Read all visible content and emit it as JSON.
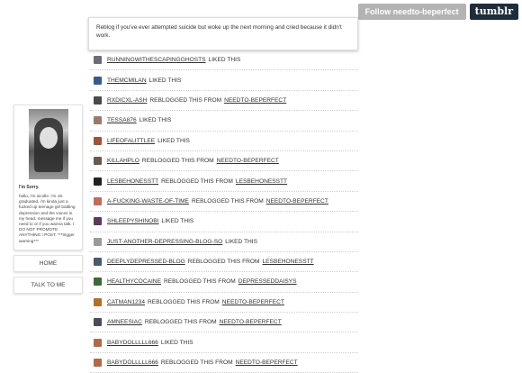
{
  "topbar": {
    "follow_label": "Follow needto-beperfect",
    "tumblr_label": "tumblr"
  },
  "post": {
    "text": "Reblog if you've ever attempted suicide but woke up the next morning and cried because it didn't work."
  },
  "notes": [
    {
      "user": "RUNNINGWITHESCAPINGGHOSTS",
      "action": "LIKED THIS",
      "from": "",
      "color": "#6b6b7a"
    },
    {
      "user": "THEMCMILAN",
      "action": "LIKED THIS",
      "from": "",
      "color": "#3a5a8a"
    },
    {
      "user": "RXDICXL-ASH",
      "action": "REBLOGGED THIS FROM",
      "from": "NEEDTO-BEPERFECT",
      "color": "#4a4a4a"
    },
    {
      "user": "TESSA876",
      "action": "LIKED THIS",
      "from": "",
      "color": "#9a7a6a"
    },
    {
      "user": "LIFEOFALITTLEE",
      "action": "LIKED THIS",
      "from": "",
      "color": "#a0523a"
    },
    {
      "user": "KILLAHPLO",
      "action": "REBLOGGED THIS FROM",
      "from": "NEEDTO-BEPERFECT",
      "color": "#6a5a4a"
    },
    {
      "user": "LESBEHONESSTT",
      "action": "REBLOGGED THIS FROM",
      "from": "LESBEHONESSTT",
      "color": "#222222"
    },
    {
      "user": "A-FUCKING-WASTE-OF-TIME",
      "action": "REBLOGGED THIS FROM",
      "from": "NEEDTO-BEPERFECT",
      "color": "#c46a5a"
    },
    {
      "user": "SHLEEPYSHINOBI",
      "action": "LIKED THIS",
      "from": "",
      "color": "#5a3a5a"
    },
    {
      "user": "JUST-ANOTHER-DEPRESSING-BLOG-SO",
      "action": "LIKED THIS",
      "from": "",
      "color": "#9a9a9a"
    },
    {
      "user": "DEEPLYDEPRESSED-BLOG",
      "action": "REBLOGGED THIS FROM",
      "from": "LESBEHONESSTT",
      "color": "#4a5a6a"
    },
    {
      "user": "HEALTHYCOCAINE",
      "action": "REBLOGGED THIS FROM",
      "from": "DEPRESSEDDAISYS",
      "color": "#3a6a3a"
    },
    {
      "user": "CATMAN1234",
      "action": "REBLOGGED THIS FROM",
      "from": "NEEDTO-BEPERFECT",
      "color": "#b0702a"
    },
    {
      "user": "AMNEESIAC",
      "action": "REBLOGGED THIS FROM",
      "from": "NEEDTO-BEPERFECT",
      "color": "#4a4a5a"
    },
    {
      "user": "BABYDOLLLLL666",
      "action": "LIKED THIS",
      "from": "",
      "color": "#b06a4a"
    },
    {
      "user": "BABYDOLLLLL666",
      "action": "REBLOGGED THIS FROM",
      "from": "NEEDTO-BEPERFECT",
      "color": "#b06a4a"
    }
  ],
  "sidebar": {
    "name": "I'm Sorry.",
    "description": "hello, i'm nicolle. i'm 19. graduated. i'm kinda just a fucked up teenage girl battling depression and the voices in my head. message me if you need to or if you wanna talk. I DO NOT PROMOTE ANYTHING I POST. ***trigger warning***",
    "home_label": "HOME",
    "talk_label": "TALK TO ME"
  }
}
